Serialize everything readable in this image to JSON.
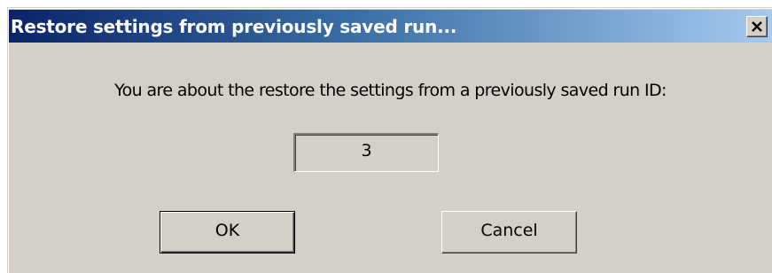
{
  "dialog": {
    "title": "Restore settings from previously saved run...",
    "message": "You are about the restore the settings from a previously saved run ID:",
    "run_id": "3",
    "ok_label": "OK",
    "cancel_label": "Cancel",
    "close_icon": "close-icon"
  },
  "colors": {
    "title_gradient_start": "#0a246a",
    "title_gradient_end": "#a6caf0",
    "face": "#d4d0c8"
  }
}
